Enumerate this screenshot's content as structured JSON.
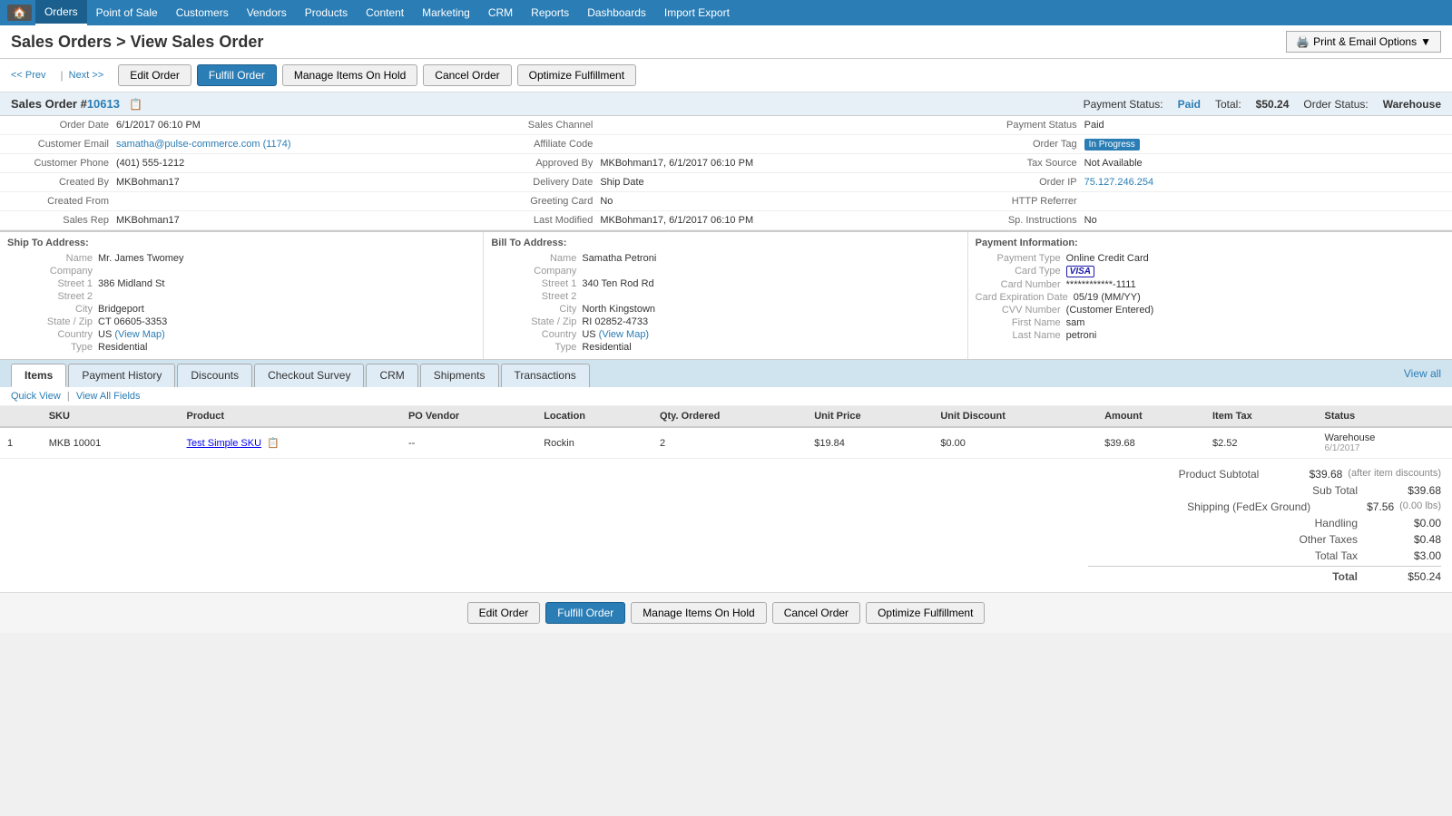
{
  "nav": {
    "home_icon": "🏠",
    "items": [
      {
        "label": "Orders",
        "active": true
      },
      {
        "label": "Point of Sale"
      },
      {
        "label": "Customers"
      },
      {
        "label": "Vendors"
      },
      {
        "label": "Products"
      },
      {
        "label": "Content"
      },
      {
        "label": "Marketing"
      },
      {
        "label": "CRM"
      },
      {
        "label": "Reports"
      },
      {
        "label": "Dashboards"
      },
      {
        "label": "Import Export"
      }
    ]
  },
  "page": {
    "title": "Sales Orders > View Sales Order",
    "prev_label": "<< Prev",
    "next_label": "Next >>",
    "print_label": "Print & Email Options"
  },
  "buttons": {
    "edit_order": "Edit Order",
    "fulfill_order": "Fulfill Order",
    "manage_hold": "Manage Items On Hold",
    "cancel_order": "Cancel Order",
    "optimize": "Optimize Fulfillment"
  },
  "order": {
    "id_label": "Sales Order #",
    "id": "10613",
    "payment_status_label": "Payment Status:",
    "payment_status": "Paid",
    "total_label": "Total:",
    "total": "$50.24",
    "order_status_label": "Order Status:",
    "order_status": "Warehouse"
  },
  "order_details": {
    "order_date_label": "Order Date",
    "order_date": "6/1/2017 06:10 PM",
    "sales_channel_label": "Sales Channel",
    "sales_channel": "",
    "payment_status_label": "Payment Status",
    "payment_status": "Paid",
    "customer_email_label": "Customer Email",
    "customer_email": "samatha@pulse-commerce.com",
    "customer_email_link": "(1174)",
    "affiliate_code_label": "Affiliate Code",
    "affiliate_code": "",
    "order_tag_label": "Order Tag",
    "order_tag": "In Progress",
    "customer_phone_label": "Customer Phone",
    "customer_phone": "(401) 555-1212",
    "approved_by_label": "Approved By",
    "approved_by": "MKBohman17, 6/1/2017 06:10 PM",
    "tax_source_label": "Tax Source",
    "tax_source": "Not Available",
    "created_by_label": "Created By",
    "created_by": "MKBohman17",
    "delivery_date_label": "Delivery Date",
    "delivery_date": "Ship Date",
    "order_ip_label": "Order IP",
    "order_ip": "75.127.246.254",
    "created_from_label": "Created From",
    "created_from": "",
    "greeting_card_label": "Greeting Card",
    "greeting_card": "No",
    "http_referrer_label": "HTTP Referrer",
    "http_referrer": "",
    "sales_rep_label": "Sales Rep",
    "sales_rep": "MKBohman17",
    "last_modified_label": "Last Modified",
    "last_modified": "MKBohman17, 6/1/2017 06:10 PM",
    "sp_instructions_label": "Sp. Instructions",
    "sp_instructions": "No"
  },
  "ship_to": {
    "title": "Ship To Address:",
    "name_label": "Name",
    "name": "Mr. James Twomey",
    "company_label": "Company",
    "company": "",
    "street1_label": "Street 1",
    "street1": "386 Midland St",
    "street2_label": "Street 2",
    "street2": "",
    "city_label": "City",
    "city": "Bridgeport",
    "state_zip_label": "State / Zip",
    "state_zip": "CT 06605-3353",
    "country_label": "Country",
    "country": "US",
    "country_link": "(View Map)",
    "type_label": "Type",
    "type": "Residential"
  },
  "bill_to": {
    "title": "Bill To Address:",
    "name_label": "Name",
    "name": "Samatha Petroni",
    "company_label": "Company",
    "company": "",
    "street1_label": "Street 1",
    "street1": "340 Ten Rod Rd",
    "street2_label": "Street 2",
    "street2": "",
    "city_label": "City",
    "city": "North Kingstown",
    "state_zip_label": "State / Zip",
    "state_zip": "RI 02852-4733",
    "country_label": "Country",
    "country": "US",
    "country_link": "(View Map)",
    "type_label": "Type",
    "type": "Residential"
  },
  "payment_info": {
    "title": "Payment Information:",
    "payment_type_label": "Payment Type",
    "payment_type": "Online Credit Card",
    "card_type_label": "Card Type",
    "card_type": "VISA",
    "card_number_label": "Card Number",
    "card_number": "************-1111",
    "card_expiry_label": "Card Expiration Date",
    "card_expiry": "05/19 (MM/YY)",
    "cvv_label": "CVV Number",
    "cvv": "(Customer Entered)",
    "first_name_label": "First Name",
    "first_name": "sam",
    "last_name_label": "Last Name",
    "last_name": "petroni"
  },
  "tabs": [
    {
      "label": "Items",
      "active": true
    },
    {
      "label": "Payment History"
    },
    {
      "label": "Discounts"
    },
    {
      "label": "Checkout Survey"
    },
    {
      "label": "CRM"
    },
    {
      "label": "Shipments"
    },
    {
      "label": "Transactions"
    }
  ],
  "view_all": "View all",
  "quick_view": "Quick View",
  "view_all_fields": "View All Fields",
  "table": {
    "headers": [
      "",
      "SKU",
      "Product",
      "PO Vendor",
      "Location",
      "Qty. Ordered",
      "Unit Price",
      "Unit Discount",
      "Amount",
      "Item Tax",
      "Status"
    ],
    "rows": [
      {
        "num": "1",
        "sku": "MKB 10001",
        "product": "Test Simple SKU",
        "po_vendor": "--",
        "location": "Rockin",
        "qty": "2",
        "unit_price": "$19.84",
        "unit_discount": "$0.00",
        "amount": "$39.68",
        "item_tax": "$2.52",
        "status": "Warehouse",
        "status_date": "6/1/2017"
      }
    ]
  },
  "totals": {
    "product_subtotal_label": "Product Subtotal",
    "product_subtotal": "$39.68",
    "product_subtotal_note": "(after item discounts)",
    "sub_total_label": "Sub Total",
    "sub_total": "$39.68",
    "shipping_label": "Shipping (FedEx Ground)",
    "shipping": "$7.56",
    "shipping_note": "(0.00 lbs)",
    "handling_label": "Handling",
    "handling": "$0.00",
    "other_taxes_label": "Other Taxes",
    "other_taxes": "$0.48",
    "total_tax_label": "Total Tax",
    "total_tax": "$3.00",
    "total_label": "Total",
    "total": "$50.24"
  },
  "bottom_bar": {
    "manage_hold_label": "Manage Items On Hold"
  }
}
